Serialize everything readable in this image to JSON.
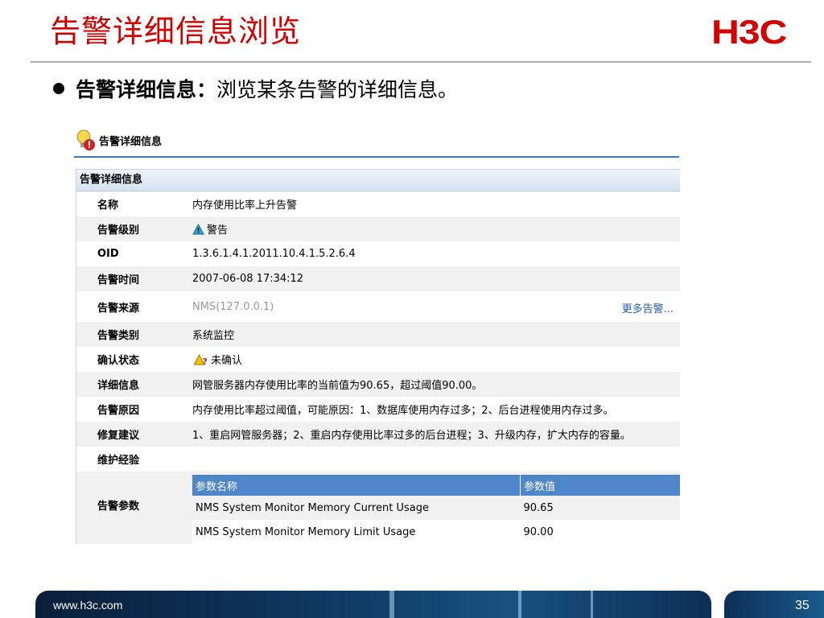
{
  "slide": {
    "title": "告警详细信息浏览",
    "logo": "H3C",
    "bullet_bold": "告警详细信息：",
    "bullet_text": "浏览某条告警的详细信息。",
    "footer_url": "www.h3c.com",
    "page_number": "35"
  },
  "panel": {
    "title": "告警详细信息",
    "icon": "alarm-bulb-icon",
    "section_header": "告警详细信息"
  },
  "details": {
    "name": {
      "label": "名称",
      "value": "内存使用比率上升告警"
    },
    "level": {
      "label": "告警级别",
      "value": "警告",
      "icon": "warning-triangle-icon"
    },
    "oid": {
      "label": "OID",
      "value": "1.3.6.1.4.1.2011.10.4.1.5.2.6.4"
    },
    "time": {
      "label": "告警时间",
      "value": "2007-06-08 17:34:12"
    },
    "source": {
      "label": "告警来源",
      "value": "NMS(127.0.0.1)",
      "link": "更多告警..."
    },
    "category": {
      "label": "告警类别",
      "value": "系统监控"
    },
    "ack": {
      "label": "确认状态",
      "value": "未确认",
      "icon": "unconfirmed-icon"
    },
    "detail": {
      "label": "详细信息",
      "value": "网管服务器内存使用比率的当前值为90.65，超过阈值90.00。"
    },
    "reason": {
      "label": "告警原因",
      "value": "内存使用比率超过阈值，可能原因：1、数据库使用内存过多；2、后台进程使用内存过多。"
    },
    "fix": {
      "label": "修复建议",
      "value": "1、重启网管服务器；2、重启内存使用比率过多的后台进程；3、升级内存，扩大内存的容量。"
    },
    "experience": {
      "label": "维护经验",
      "value": ""
    },
    "params_label": "告警参数"
  },
  "params": {
    "headers": [
      "参数名称",
      "参数值"
    ],
    "rows": [
      [
        "NMS System Monitor Memory Current Usage",
        "90.65"
      ],
      [
        "NMS System Monitor Memory Limit Usage",
        "90.00"
      ]
    ]
  },
  "colors": {
    "title_red": "#d20000",
    "header_blue": "#4f86c9",
    "rule_blue": "#3a78c4",
    "link_blue": "#2a5db0"
  }
}
